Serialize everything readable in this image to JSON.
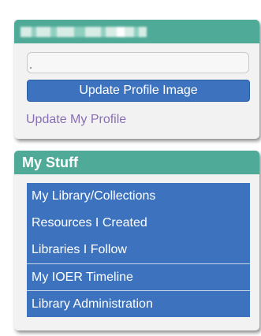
{
  "profile": {
    "name_redacted": "",
    "file_input_value": "",
    "update_image_label": "Update Profile Image",
    "update_profile_label": "Update My Profile"
  },
  "my_stuff": {
    "title": "My Stuff",
    "items": [
      {
        "label": "My Library/Collections"
      },
      {
        "label": "Resources I Created"
      },
      {
        "label": "Libraries I Follow"
      },
      {
        "label": "My IOER Timeline"
      },
      {
        "label": "Library Administration"
      }
    ]
  },
  "colors": {
    "header_teal": "#4faa97",
    "button_blue": "#3d73be",
    "link_purple": "#8a6fb5",
    "panel_bg": "#f2f2f2"
  }
}
